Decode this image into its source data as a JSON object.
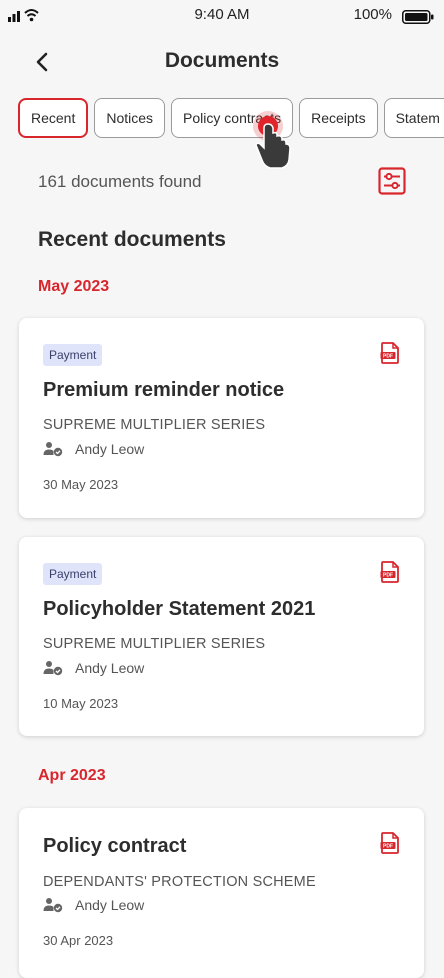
{
  "status_bar": {
    "time": "9:40 AM",
    "battery_percent": "100%"
  },
  "header": {
    "title": "Documents"
  },
  "filter_chips": [
    {
      "label": "Recent",
      "active": true
    },
    {
      "label": "Notices",
      "active": false
    },
    {
      "label": "Policy contracts",
      "active": false
    },
    {
      "label": "Receipts",
      "active": false
    },
    {
      "label": "Statem",
      "active": false
    }
  ],
  "results": {
    "count_text": "161 documents found"
  },
  "section": {
    "title": "Recent documents"
  },
  "groups": [
    {
      "month": "May 2023",
      "documents": [
        {
          "badge": "Payment",
          "title": "Premium reminder notice",
          "plan": "SUPREME MULTIPLIER SERIES",
          "owner": "Andy Leow",
          "date": "30 May 2023"
        },
        {
          "badge": "Payment",
          "title": "Policyholder Statement 2021",
          "plan": "SUPREME MULTIPLIER SERIES",
          "owner": "Andy Leow",
          "date": "10 May 2023"
        }
      ]
    },
    {
      "month": "Apr 2023",
      "documents": [
        {
          "title": "Policy contract",
          "plan": "DEPENDANTS' PROTECTION SCHEME",
          "owner": "Andy Leow",
          "date": "30 Apr 2023"
        }
      ]
    }
  ],
  "colors": {
    "accent": "#d8262d",
    "badge_bg": "#dfe4fb",
    "background": "#f6f6f6"
  },
  "icons": [
    "signal-icon",
    "wifi-icon",
    "battery-icon",
    "back-arrow-icon",
    "filter-icon",
    "pdf-icon",
    "person-shield-icon",
    "tap-hand-icon"
  ]
}
